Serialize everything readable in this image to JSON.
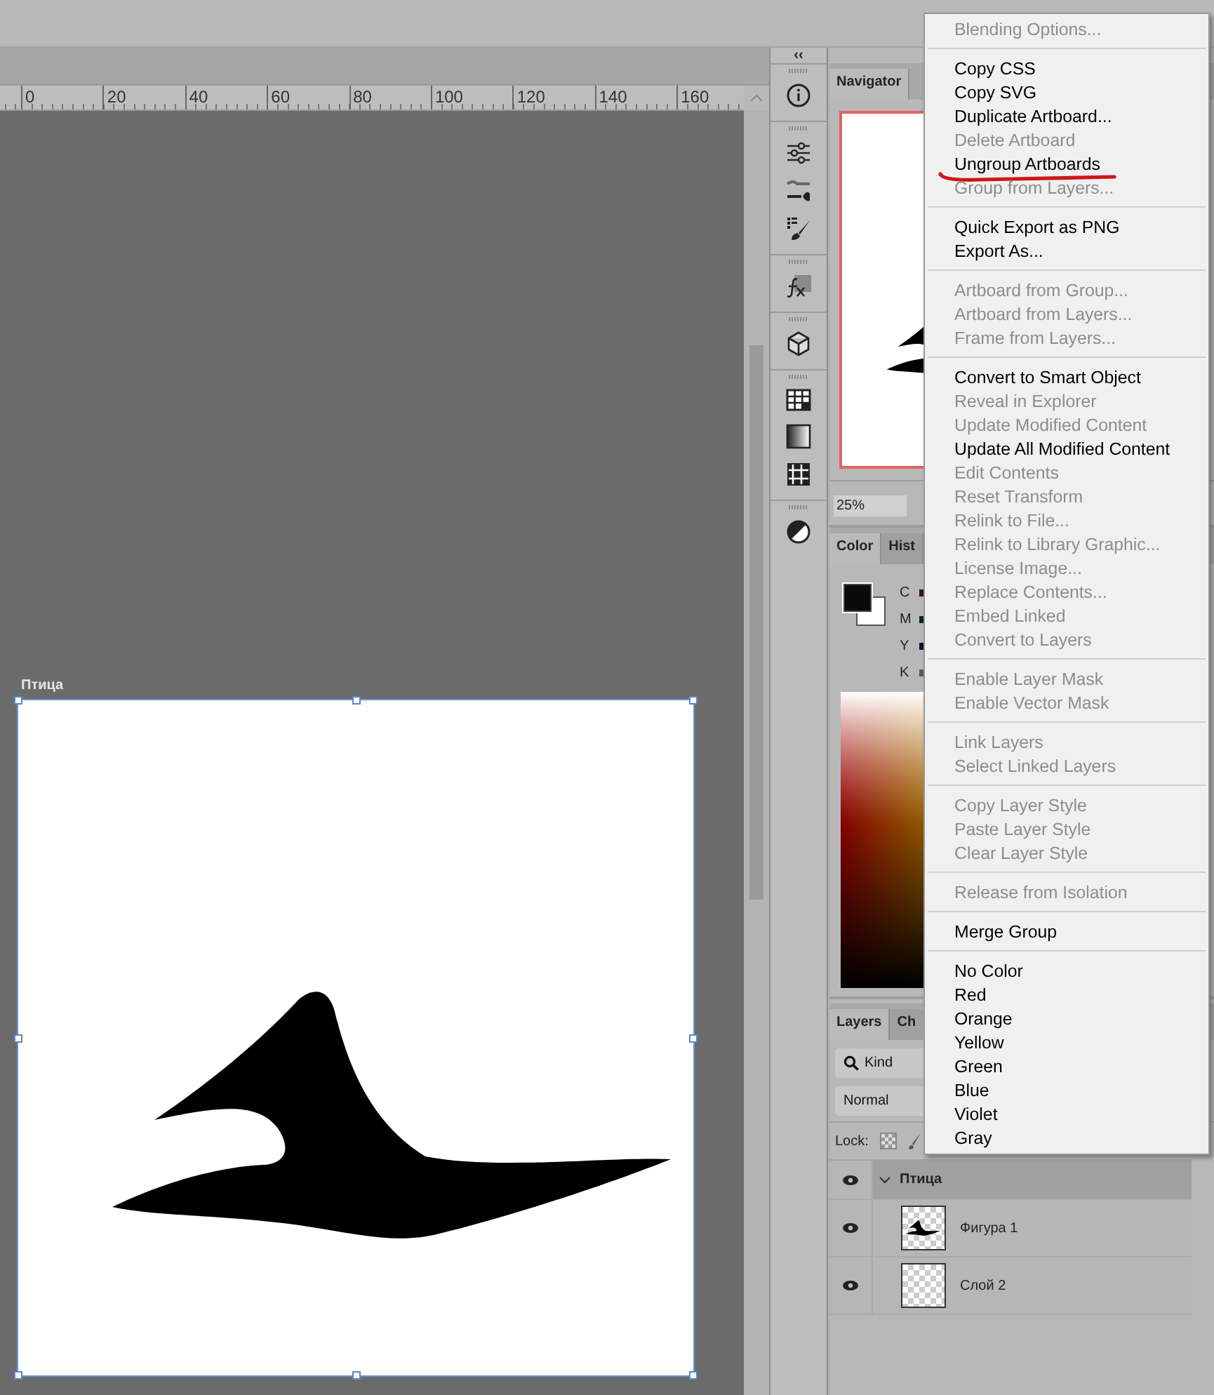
{
  "ruler": {
    "labels": [
      "0",
      "20",
      "40",
      "60",
      "80",
      "100",
      "120",
      "140",
      "160"
    ]
  },
  "artboard": {
    "name": "Птица"
  },
  "dock": {
    "collapse": "‹‹"
  },
  "navigator": {
    "tab": "Navigator",
    "zoom": "25%"
  },
  "color_panel": {
    "tabs": [
      {
        "label": "Color",
        "selected": true
      },
      {
        "label": "Hist",
        "selected": false
      }
    ],
    "channels": [
      {
        "label": "C",
        "color": "#3a1010"
      },
      {
        "label": "M",
        "color": "#0f2a18"
      },
      {
        "label": "Y",
        "color": "#10103a"
      },
      {
        "label": "K",
        "color": "#5a5a5a"
      }
    ]
  },
  "layers_panel": {
    "tabs": [
      {
        "label": "Layers",
        "selected": true
      },
      {
        "label": "Ch",
        "selected": false
      }
    ],
    "filter": "Kind",
    "blend_mode": "Normal",
    "lock_label": "Lock:",
    "layers": [
      {
        "name": "Птица",
        "kind": "group",
        "visible": true,
        "expanded": true,
        "selected": true,
        "children": [
          {
            "name": "Фигура 1",
            "kind": "shape",
            "visible": true,
            "selected": false
          },
          {
            "name": "Слой 2",
            "kind": "pixel",
            "visible": true,
            "selected": false
          }
        ]
      }
    ]
  },
  "context_menu": {
    "groups": [
      [
        {
          "label": "Blending Options...",
          "disabled": true,
          "marked": false
        }
      ],
      [
        {
          "label": "Copy CSS",
          "disabled": false,
          "marked": false
        },
        {
          "label": "Copy SVG",
          "disabled": false,
          "marked": false
        },
        {
          "label": "Duplicate Artboard...",
          "disabled": false,
          "marked": false
        },
        {
          "label": "Delete Artboard",
          "disabled": true,
          "marked": false
        },
        {
          "label": "Ungroup Artboards",
          "disabled": false,
          "marked": true
        },
        {
          "label": "Group from Layers...",
          "disabled": true,
          "marked": false
        }
      ],
      [
        {
          "label": "Quick Export as PNG",
          "disabled": false,
          "marked": false
        },
        {
          "label": "Export As...",
          "disabled": false,
          "marked": false
        }
      ],
      [
        {
          "label": "Artboard from Group...",
          "disabled": true,
          "marked": false
        },
        {
          "label": "Artboard from Layers...",
          "disabled": true,
          "marked": false
        },
        {
          "label": "Frame from Layers...",
          "disabled": true,
          "marked": false
        }
      ],
      [
        {
          "label": "Convert to Smart Object",
          "disabled": false,
          "marked": false
        },
        {
          "label": "Reveal in Explorer",
          "disabled": true,
          "marked": false
        },
        {
          "label": "Update Modified Content",
          "disabled": true,
          "marked": false
        },
        {
          "label": "Update All Modified Content",
          "disabled": false,
          "marked": false
        },
        {
          "label": "Edit Contents",
          "disabled": true,
          "marked": false
        },
        {
          "label": "Reset Transform",
          "disabled": true,
          "marked": false
        },
        {
          "label": "Relink to File...",
          "disabled": true,
          "marked": false
        },
        {
          "label": "Relink to Library Graphic...",
          "disabled": true,
          "marked": false
        },
        {
          "label": "License Image...",
          "disabled": true,
          "marked": false
        },
        {
          "label": "Replace Contents...",
          "disabled": true,
          "marked": false
        },
        {
          "label": "Embed Linked",
          "disabled": true,
          "marked": false
        },
        {
          "label": "Convert to Layers",
          "disabled": true,
          "marked": false
        }
      ],
      [
        {
          "label": "Enable Layer Mask",
          "disabled": true,
          "marked": false
        },
        {
          "label": "Enable Vector Mask",
          "disabled": true,
          "marked": false
        }
      ],
      [
        {
          "label": "Link Layers",
          "disabled": true,
          "marked": false
        },
        {
          "label": "Select Linked Layers",
          "disabled": true,
          "marked": false
        }
      ],
      [
        {
          "label": "Copy Layer Style",
          "disabled": true,
          "marked": false
        },
        {
          "label": "Paste Layer Style",
          "disabled": true,
          "marked": false
        },
        {
          "label": "Clear Layer Style",
          "disabled": true,
          "marked": false
        }
      ],
      [
        {
          "label": "Release from Isolation",
          "disabled": true,
          "marked": false
        }
      ],
      [
        {
          "label": "Merge Group",
          "disabled": false,
          "marked": false
        }
      ],
      [
        {
          "label": "No Color",
          "disabled": false,
          "marked": false
        },
        {
          "label": "Red",
          "disabled": false,
          "marked": false
        },
        {
          "label": "Orange",
          "disabled": false,
          "marked": false
        },
        {
          "label": "Yellow",
          "disabled": false,
          "marked": false
        },
        {
          "label": "Green",
          "disabled": false,
          "marked": false
        },
        {
          "label": "Blue",
          "disabled": false,
          "marked": false
        },
        {
          "label": "Violet",
          "disabled": false,
          "marked": false
        },
        {
          "label": "Gray",
          "disabled": false,
          "marked": false
        }
      ]
    ]
  }
}
